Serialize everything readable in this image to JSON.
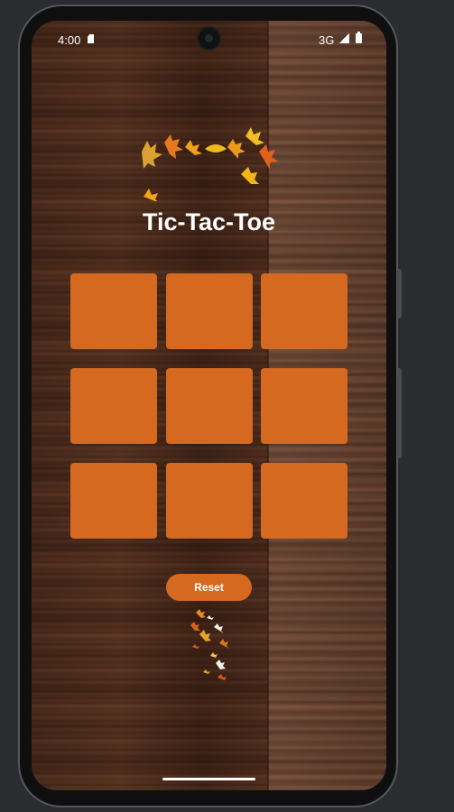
{
  "status_bar": {
    "time": "4:00",
    "network": "3G",
    "icons": [
      "sd-card-icon",
      "signal-icon",
      "battery-icon"
    ]
  },
  "app": {
    "title": "Tic-Tac-Toe",
    "board": [
      "",
      "",
      "",
      "",
      "",
      "",
      "",
      "",
      ""
    ],
    "reset_label": "Reset"
  },
  "colors": {
    "cell": "#d4691f",
    "button": "#d4691f",
    "text": "#ffffff"
  },
  "decorations": [
    "autumn-leaves-garland",
    "falling-leaves"
  ]
}
